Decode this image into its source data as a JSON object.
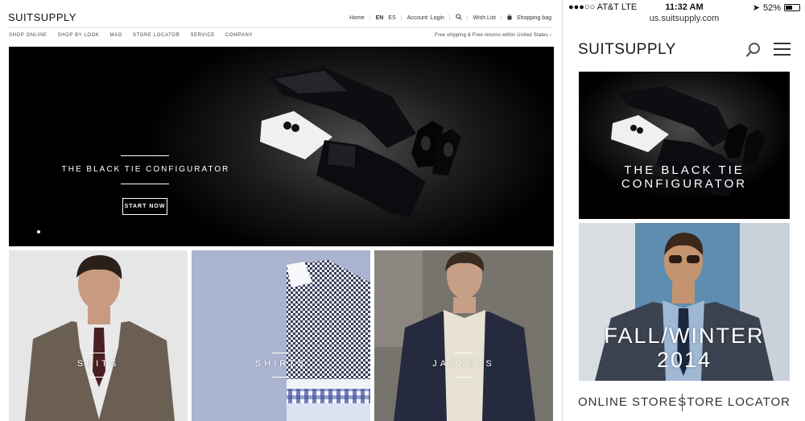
{
  "desktop": {
    "logo": "SUITSUPPLY",
    "utility": {
      "home": "Home",
      "lang_en": "EN",
      "lang_es": "ES",
      "account": "Account: Login",
      "search_icon": "search-icon",
      "wishlist": "Wish List",
      "bag": "Shopping bag"
    },
    "nav": [
      "SHOP ONLINE",
      "SHOP BY LOOK",
      "MAG",
      "STORE LOCATOR",
      "SERVICE",
      "COMPANY"
    ],
    "shipping": "Free shipping & Free returns within United States",
    "hero": {
      "title": "THE BLACK TIE CONFIGURATOR",
      "cta": "START NOW"
    },
    "tiles": [
      {
        "label": "SUITS"
      },
      {
        "label": "SHIRTS"
      },
      {
        "label": "JACKETS"
      }
    ]
  },
  "mobile": {
    "status": {
      "carrier": "●●●○○ AT&T  LTE",
      "time": "11:32 AM",
      "battery": "52%",
      "battery_level": 0.52
    },
    "url": "us.suitsupply.com",
    "logo": "SUITSUPPLY",
    "icons": [
      "search-icon",
      "hamburger-menu-icon"
    ],
    "hero_title_line1": "THE BLACK TIE",
    "hero_title_line2": "CONFIGURATOR",
    "fw_line1": "FALL/WINTER",
    "fw_line2": "2014",
    "links": {
      "online_store": "ONLINE STORE",
      "store_locator": "STORE LOCATOR"
    }
  },
  "colors": {
    "text": "#222222",
    "hero_bg": "#000000",
    "tile_suits_bg": "#e6e6e6",
    "tile_shirts_bg": "#aab3cf",
    "tile_jackets_bg": "#6d6a66",
    "fw_sky": "#5a87a8"
  }
}
